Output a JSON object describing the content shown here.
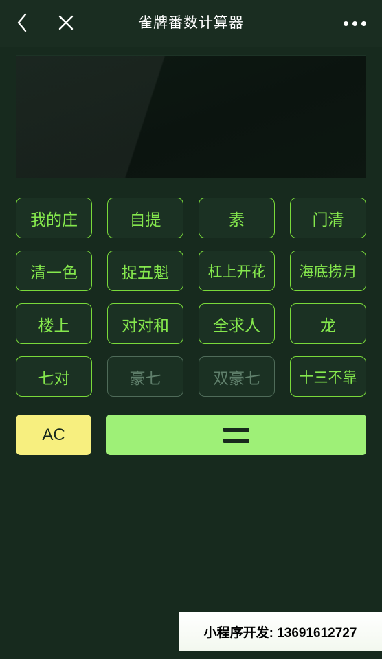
{
  "header": {
    "title": "雀牌番数计算器",
    "back_icon": "chevron-left-icon",
    "close_icon": "close-icon",
    "more_icon": "more-dots-icon"
  },
  "display": {
    "value": ""
  },
  "keypad": {
    "rows": [
      [
        {
          "label": "我的庄",
          "state": "enabled"
        },
        {
          "label": "自提",
          "state": "enabled"
        },
        {
          "label": "素",
          "state": "enabled"
        },
        {
          "label": "门清",
          "state": "enabled"
        }
      ],
      [
        {
          "label": "清一色",
          "state": "enabled"
        },
        {
          "label": "捉五魁",
          "state": "enabled"
        },
        {
          "label": "杠上开花",
          "state": "enabled"
        },
        {
          "label": "海底捞月",
          "state": "enabled"
        }
      ],
      [
        {
          "label": "楼上",
          "state": "enabled"
        },
        {
          "label": "对对和",
          "state": "enabled"
        },
        {
          "label": "全求人",
          "state": "enabled"
        },
        {
          "label": "龙",
          "state": "enabled"
        }
      ],
      [
        {
          "label": "七对",
          "state": "enabled"
        },
        {
          "label": "豪七",
          "state": "disabled"
        },
        {
          "label": "双豪七",
          "state": "disabled"
        },
        {
          "label": "十三不靠",
          "state": "enabled"
        }
      ]
    ]
  },
  "actions": {
    "clear_label": "AC",
    "equals_label": "=",
    "equals_icon": "equals-icon"
  },
  "banner": {
    "text": "小程序开发: 13691612727"
  },
  "colors": {
    "background": "#172a1e",
    "key_border": "#79d93a",
    "key_text": "#85e84d",
    "key_disabled": "#5f7f6b",
    "clear_bg": "#f7ef7f",
    "equals_bg": "#9ef077",
    "display_bg": "#0b140f"
  }
}
